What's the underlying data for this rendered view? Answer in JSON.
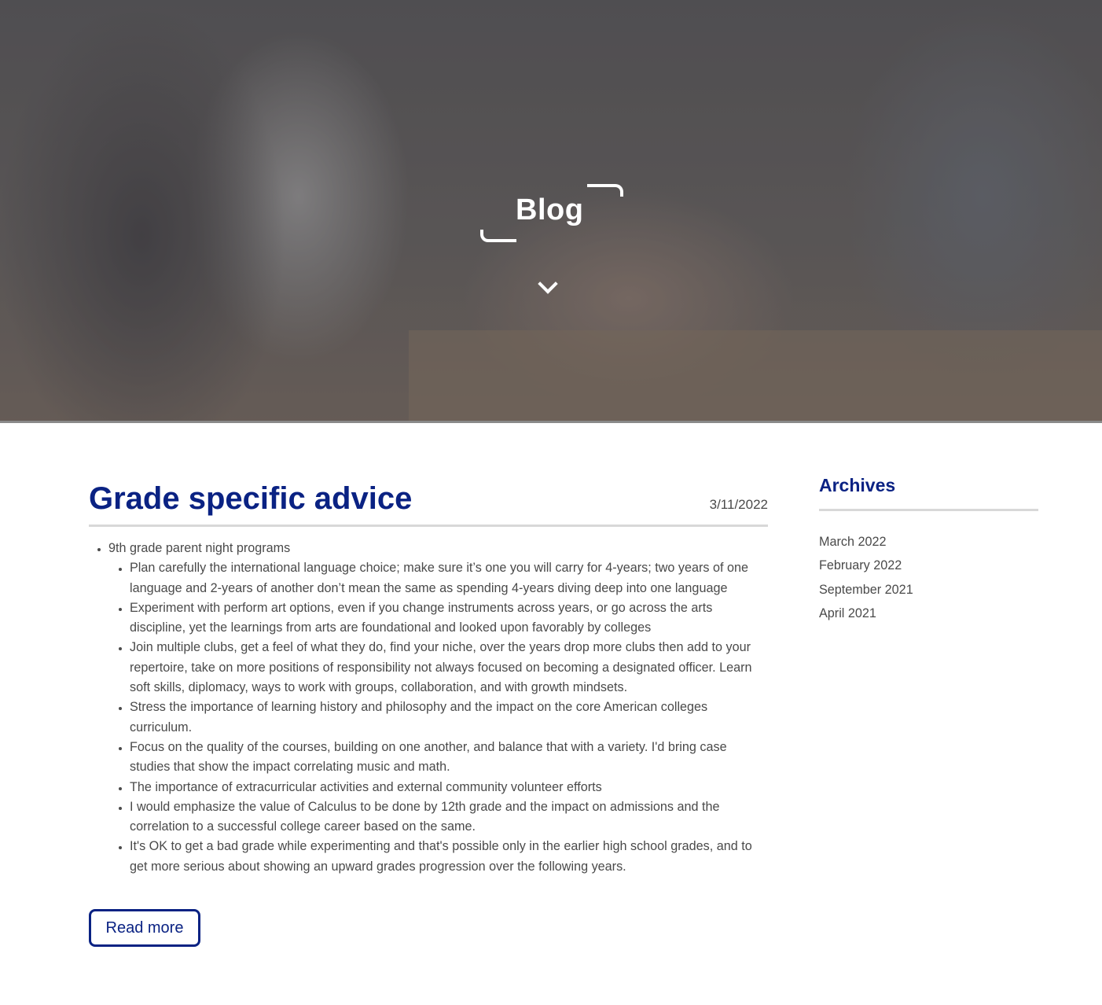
{
  "hero": {
    "title": "Blog"
  },
  "post": {
    "title": "Grade specific advice",
    "date": "3/11/2022",
    "top_item": "9th grade parent night programs",
    "items": [
      "Plan carefully the international language choice; make sure it’s one you will carry for 4-years; two years of one language and 2-years of another don’t mean the same as spending 4-years diving deep into one language",
      "Experiment with perform art options, even if you change instruments across years, or go across the arts discipline, yet the learnings from arts are foundational and looked upon favorably by colleges",
      "Join multiple clubs, get a feel of what they do, find your niche, over the years drop more clubs then add to your repertoire, take on more positions of responsibility not always focused on becoming a designated officer. Learn soft skills, diplomacy, ways to work with groups, collaboration, and with growth mindsets.",
      "Stress the importance of learning history and philosophy and the impact on the core American colleges curriculum.",
      "Focus on the quality of the courses, building on one another, and balance that with a variety. I'd bring case studies that show the impact correlating music and math.",
      "The importance of extracurricular activities and external community volunteer efforts",
      "I would emphasize the value of Calculus to be done by 12th grade and the impact on admissions and the correlation to a successful college career based on the same.",
      "It's OK to get a bad grade while experimenting and that's possible only in the earlier high school grades, and to get more serious about showing an upward grades progression over the following years."
    ],
    "read_more": "Read more"
  },
  "archives": {
    "title": "Archives",
    "items": [
      "March 2022",
      "February 2022",
      "September 2021",
      "April 2021"
    ]
  }
}
